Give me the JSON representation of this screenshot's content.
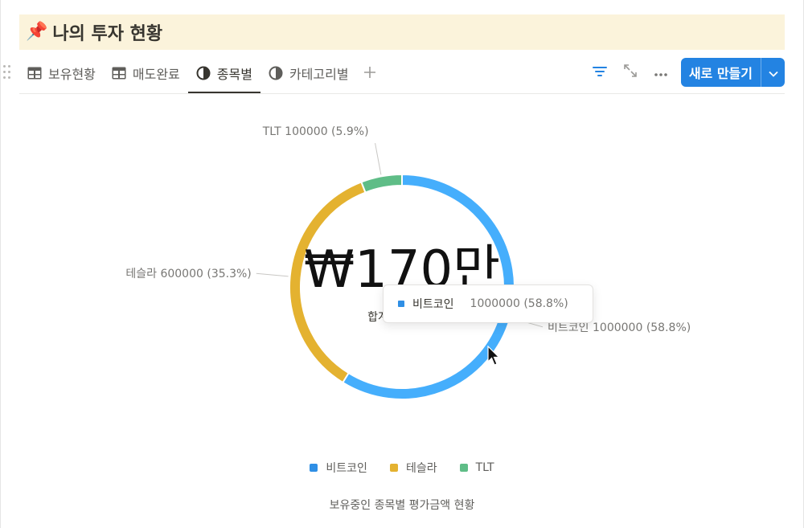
{
  "page": {
    "icon": "📌",
    "title": "나의 투자 현황"
  },
  "tabs": [
    {
      "label": "보유현황",
      "icon": "table-icon"
    },
    {
      "label": "매도완료",
      "icon": "table-icon"
    },
    {
      "label": "종목별",
      "icon": "pie-chart-icon"
    },
    {
      "label": "카테고리별",
      "icon": "pie-chart-icon"
    }
  ],
  "active_tab": "종목별",
  "toolbar": {
    "new_label": "새로 만들기"
  },
  "colors": {
    "accent": "#2383e2",
    "bitcoin": "#45aefc",
    "tesla": "#e4b230",
    "tlt": "#5fbd87",
    "title_bg": "#fbf3db"
  },
  "chart_data": {
    "type": "pie",
    "variant": "donut",
    "center_value": "₩170만",
    "center_label": "합계",
    "slices": [
      {
        "name": "비트코인",
        "value": 1000000,
        "percent": 58.8,
        "label": "비트코인 1000000 (58.8%)",
        "color": "#45aefc"
      },
      {
        "name": "테슬라",
        "value": 600000,
        "percent": 35.3,
        "label": "테슬라 600000 (35.3%)",
        "color": "#e4b230"
      },
      {
        "name": "TLT",
        "value": 100000,
        "percent": 5.9,
        "label": "TLT 100000 (5.9%)",
        "color": "#5fbd87"
      }
    ],
    "legend": [
      "비트코인",
      "테슬라",
      "TLT"
    ],
    "legend_placement": "bottom",
    "caption": "보유중인 종목별 평가금액 현황"
  },
  "tooltip": {
    "name": "비트코인",
    "value": "1000000 (58.8%)"
  }
}
